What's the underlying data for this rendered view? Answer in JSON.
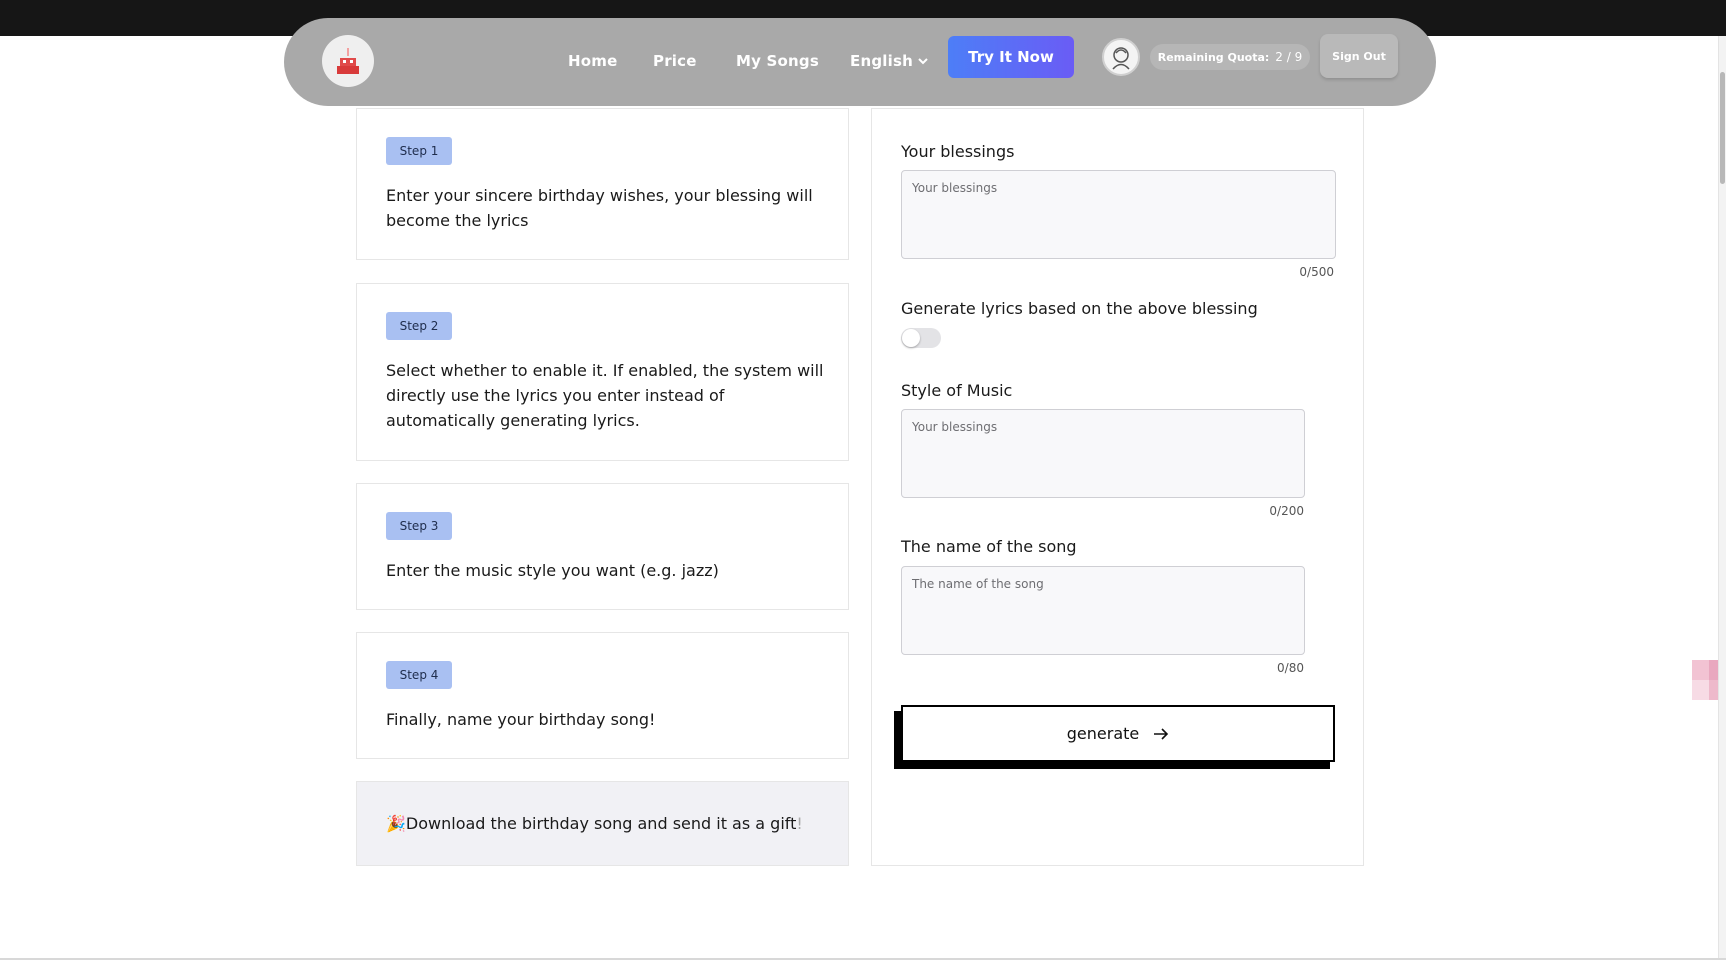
{
  "nav": {
    "links": [
      "Home",
      "Price",
      "My Songs"
    ],
    "language": "English",
    "cta": "Try It Now",
    "quota_label": "Remaining Quota:",
    "quota_value": "2 / 9",
    "sign_out": "Sign Out"
  },
  "steps": [
    {
      "badge": "Step 1",
      "text": "Enter your sincere birthday wishes, your blessing will become the lyrics"
    },
    {
      "badge": "Step 2",
      "text": "Select whether to enable it. If enabled, the system will directly use the lyrics you enter instead of automatically generating lyrics."
    },
    {
      "badge": "Step 3",
      "text": "Enter the music style you want (e.g. jazz)"
    },
    {
      "badge": "Step 4",
      "text": "Finally, name your birthday song!"
    }
  ],
  "gift": {
    "emoji": "🎉",
    "text": "Download the birthday song and send it as a gift",
    "mark": "!"
  },
  "form": {
    "blessings": {
      "label": "Your blessings",
      "placeholder": "Your blessings",
      "count": "0/500"
    },
    "toggle": {
      "label": "Generate lyrics based on the above blessing",
      "enabled": false
    },
    "style": {
      "label": "Style of Music",
      "placeholder": "Your blessings",
      "count": "0/200"
    },
    "song_name": {
      "label": "The name of the song",
      "placeholder": "The name of the song",
      "count": "0/80"
    },
    "generate": "generate"
  },
  "colors": {
    "accent_gradient_start": "#4d7ef7",
    "accent_gradient_end": "#6a5cf5",
    "badge_bg": "#a9c0f2",
    "nav_bg": "#a9a9a9"
  }
}
